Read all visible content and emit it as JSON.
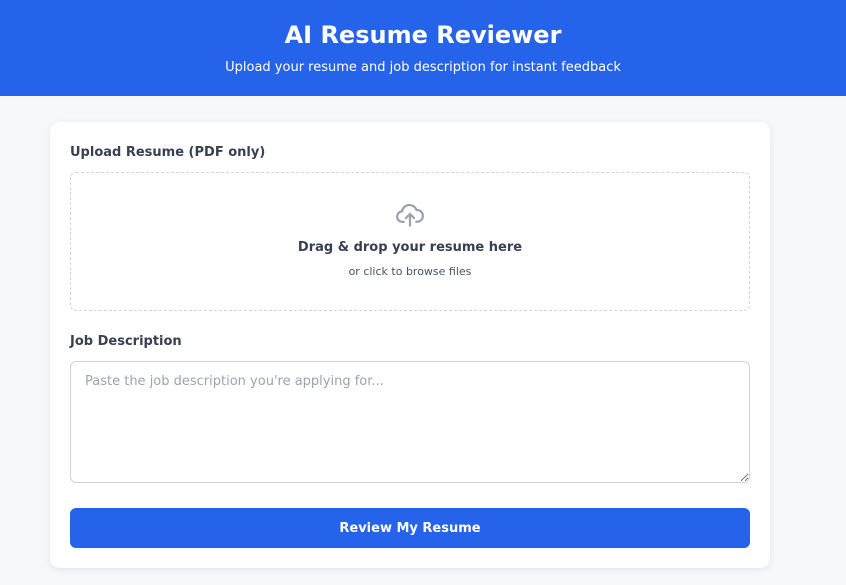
{
  "header": {
    "title": "AI Resume Reviewer",
    "subtitle": "Upload your resume and job description for instant feedback"
  },
  "upload": {
    "label": "Upload Resume (PDF only)",
    "icon": "cloud-upload-icon",
    "title": "Drag & drop your resume here",
    "subtitle": "or click to browse files"
  },
  "job": {
    "label": "Job Description",
    "placeholder": "Paste the job description you're applying for...",
    "value": ""
  },
  "actions": {
    "submit_label": "Review My Resume"
  },
  "colors": {
    "brand": "#2563eb",
    "background": "#f7f8fa",
    "card": "#ffffff",
    "muted_text": "#9ca3af"
  }
}
